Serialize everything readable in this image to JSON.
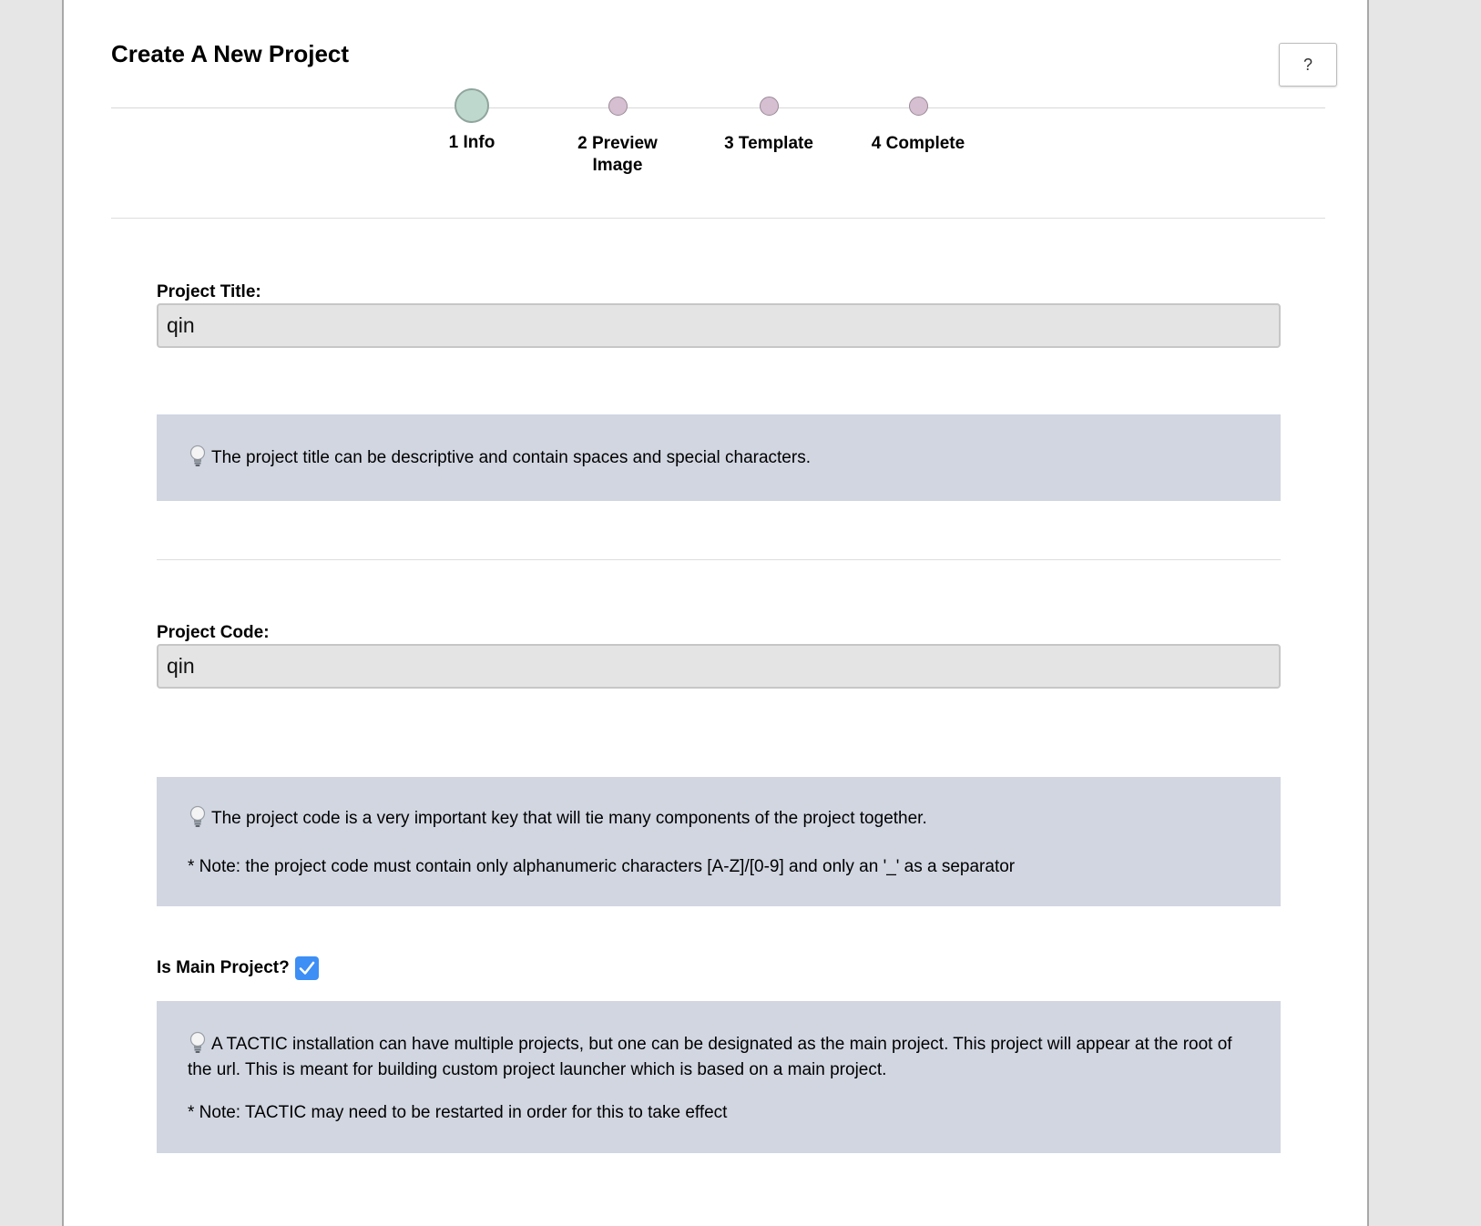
{
  "header": {
    "title": "Create A New Project",
    "help_label": "?"
  },
  "wizard": {
    "steps": [
      {
        "label": "1 Info",
        "state": "current"
      },
      {
        "label": "2 Preview Image",
        "state": "pending"
      },
      {
        "label": "3 Template",
        "state": "pending"
      },
      {
        "label": "4 Complete",
        "state": "pending"
      }
    ]
  },
  "form": {
    "project_title": {
      "label": "Project Title:",
      "value": "qin",
      "hint": "The project title can be descriptive and contain spaces and special characters."
    },
    "project_code": {
      "label": "Project Code:",
      "value": "qin",
      "hint": "The project code is a very important key that will tie many components of the project together.",
      "note": "* Note: the project code must contain only alphanumeric characters [A-Z]/[0-9] and only an '_' as a separator"
    },
    "main_project": {
      "label": "Is Main Project?",
      "checked": true,
      "hint": "A TACTIC installation can have multiple projects, but one can be designated as the main project. This project will appear at the root of the url. This is meant for building custom project launcher which is based on a main project.",
      "note": "* Note: TACTIC may need to be restarted in order for this to take effect"
    }
  },
  "colors": {
    "hint_background": "#d1d6e1",
    "step_current": "#bfd8ce",
    "step_pending": "#d5bfd0",
    "checkbox": "#3d8ef5"
  },
  "icons": {
    "hint": "lightbulb-icon",
    "checkbox": "checkmark-icon"
  }
}
